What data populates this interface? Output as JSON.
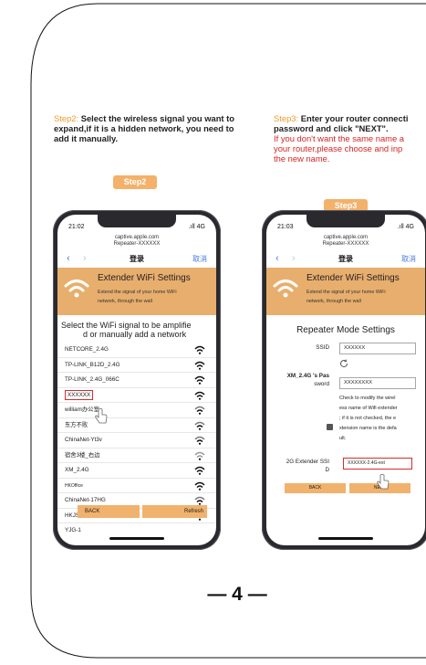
{
  "page": {
    "number": "4",
    "dash": "—"
  },
  "step2": {
    "tag": "Step2",
    "label": "Step2: ",
    "text": "Select the wireless signal you want to expand,if it is a hidden network, you need to add it manually."
  },
  "step3": {
    "tag": "Step3",
    "label": "Step3: ",
    "line1": "Enter your router connecti",
    "line2": "password and click \"NEXT\".",
    "red1": "If you don't want the same name a",
    "red2": "your router,please choose and inp",
    "red3": "the new name."
  },
  "phone1": {
    "time": "21:02",
    "signal": ".ıll 4G",
    "url_line1": "captive.apple.com",
    "url_line2": "Repeater-XXXXXX",
    "nav_title": "登录",
    "cancel": "取消",
    "banner_title": "Extender WiFi Settings",
    "banner_sub1": "Extend the signal of your home WiFi",
    "banner_sub2": "network, through the wall",
    "select_line1": "Select the WiFi signal to be amplifie",
    "select_line2": "d or manually add a network",
    "networks": [
      "NETCORE_2.4G",
      "TP-LINK_B12D_2.4G",
      "TP-LINK_2.4G_066C",
      "XXXXXX",
      "william办公室",
      "东方不败",
      "ChinaNet-Yt3v",
      "宿舍3楼_右边",
      "XM_2.4G",
      "HKOffice",
      "ChinaNet-17HG",
      "HKJSZX",
      "YJG-1"
    ],
    "back_btn": "BACK",
    "refresh_btn": "Refresh"
  },
  "phone2": {
    "time": "21:03",
    "signal": ".ıll 4G",
    "url_line1": "captive.apple.com",
    "url_line2": "Repeater-XXXXXX",
    "nav_title": "登录",
    "cancel": "取消",
    "banner_title": "Extender WiFi Settings",
    "banner_sub1": "Extend the signal of your home WiFi",
    "banner_sub2": "network, through the wall",
    "form_title": "Repeater Mode Settings",
    "ssid_label": "SSID",
    "ssid_value": "XXXXXX",
    "pwd_label1": "XM_2.4G 's Pas",
    "pwd_label2": "sword",
    "pwd_value": "XXXXXXXX",
    "desc1": "Check to modify the wirel",
    "desc2": "ess name of Wifi extender",
    "desc3": "; if it is not checked, the e",
    "desc4": "xtension name is the defa",
    "desc5": "ult.",
    "ext_label1": "2G Extender SSI",
    "ext_label2": "D",
    "ext_value": "XXXXXX-2.4G-ext",
    "back_btn": "BACK",
    "next_btn": "NEXT"
  },
  "colors": {
    "accent_orange": "#f3b16a",
    "banner": "#e8ae6d",
    "highlight_red": "#d92b2b",
    "link_blue": "#4a7bd8"
  }
}
